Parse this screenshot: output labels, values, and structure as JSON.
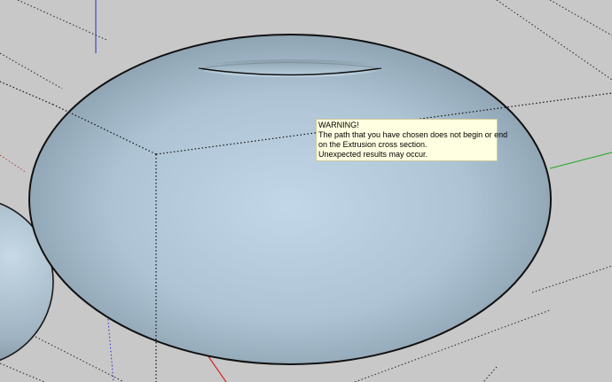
{
  "viewport": {
    "background_color": "#c8c8c8",
    "surface_color": "#b7cddc",
    "axes": {
      "red": "#d42020",
      "green": "#1aa61a",
      "blue": "#2a2ad0"
    }
  },
  "tooltip": {
    "title": "WARNING!",
    "line1": "The path that you have chosen does not begin or end",
    "line2": "on the Extrusion cross section.",
    "line3": "Unexpected results may occur."
  }
}
